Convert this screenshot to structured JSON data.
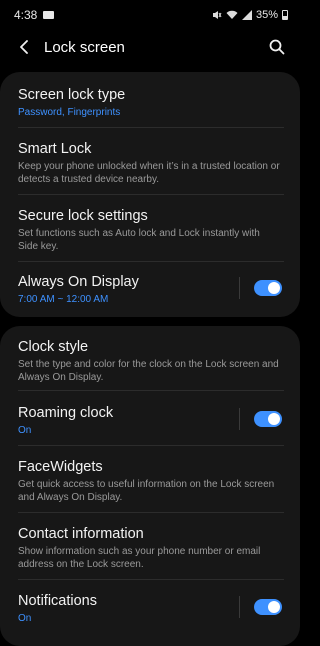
{
  "status": {
    "time": "4:38",
    "battery": "35%"
  },
  "header": {
    "title": "Lock screen"
  },
  "card1": {
    "items": [
      {
        "title": "Screen lock type",
        "subtitle": "Password, Fingerprints"
      },
      {
        "title": "Smart Lock",
        "subtitle": "Keep your phone unlocked when it’s in a trusted location or detects a trusted device nearby."
      },
      {
        "title": "Secure lock settings",
        "subtitle": "Set functions such as Auto lock and Lock instantly with Side key."
      },
      {
        "title": "Always On Display",
        "subtitle": "7:00 AM ~ 12:00 AM",
        "toggle": true
      }
    ]
  },
  "card2": {
    "items": [
      {
        "title": "Clock style",
        "subtitle": "Set the type and color for the clock on the Lock screen and Always On Display."
      },
      {
        "title": "Roaming clock",
        "subtitle": "On",
        "toggle": true
      },
      {
        "title": "FaceWidgets",
        "subtitle": "Get quick access to useful information on the Lock screen and Always On Display."
      },
      {
        "title": "Contact information",
        "subtitle": "Show information such as your phone number or email address on the Lock screen."
      },
      {
        "title": "Notifications",
        "subtitle": "On",
        "toggle": true
      }
    ]
  },
  "colors": {
    "accent": "#3e91ff",
    "background": "#000000",
    "card": "#171717"
  },
  "icons": [
    "mail-icon",
    "mute-icon",
    "wifi-icon",
    "signal-icon",
    "battery-icon",
    "back-arrow-icon",
    "search-icon"
  ]
}
